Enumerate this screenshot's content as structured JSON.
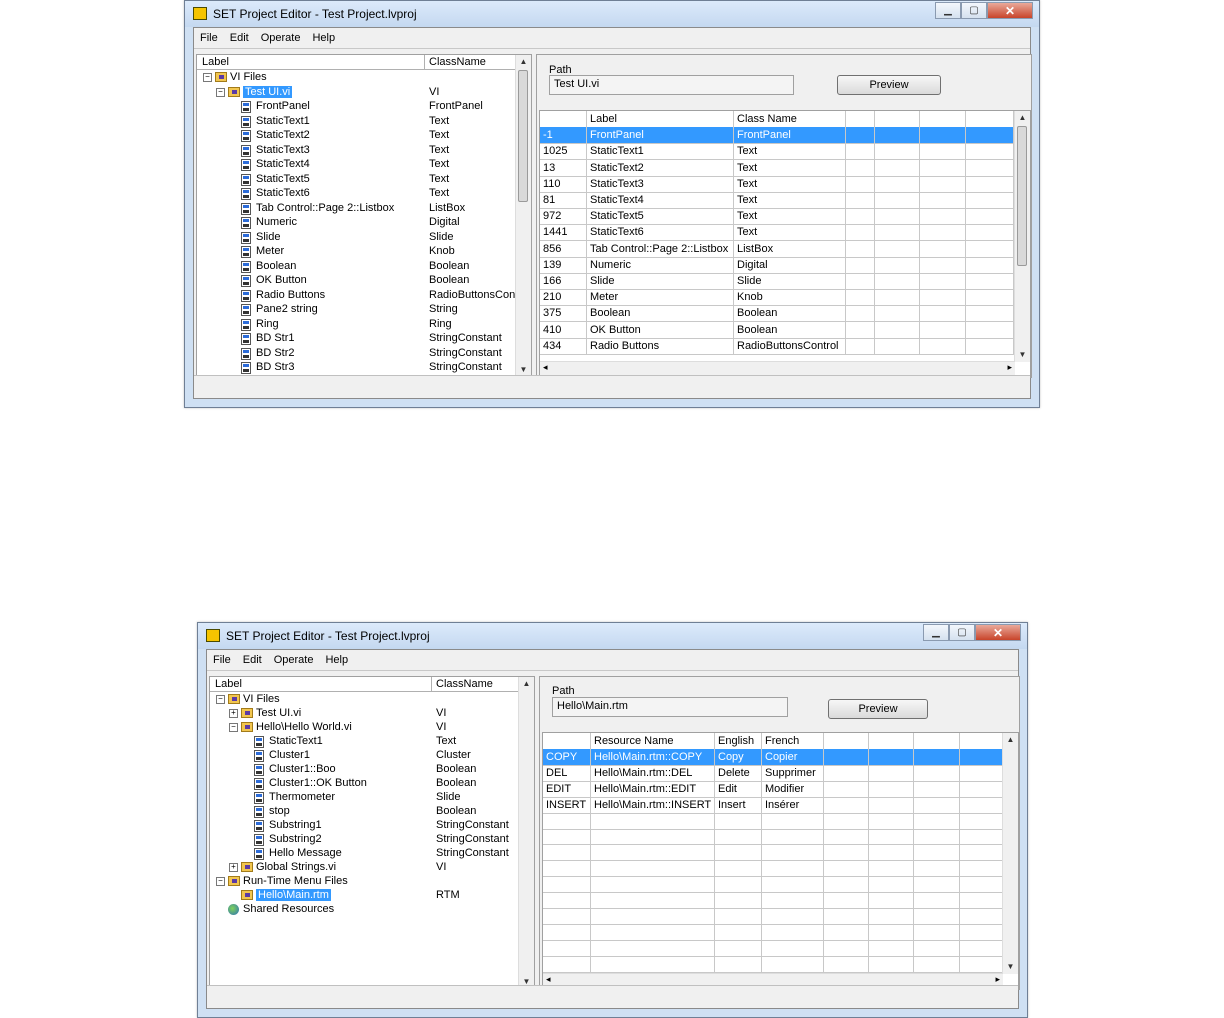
{
  "win1": {
    "title": "SET Project Editor - Test Project.lvproj",
    "menu": [
      "File",
      "Edit",
      "Operate",
      "Help"
    ],
    "tree": {
      "col_label": "Label",
      "col_class": "ClassName",
      "rows": [
        {
          "label": "VI Files",
          "cls": "",
          "icon": "folder-icon",
          "expander": "−"
        },
        {
          "label": "Test UI.vi",
          "cls": "VI",
          "icon": "folder-icon",
          "expander": "−"
        },
        {
          "label": "FrontPanel",
          "cls": "FrontPanel",
          "icon": "vi-icon"
        },
        {
          "label": "StaticText1",
          "cls": "Text",
          "icon": "vi-icon"
        },
        {
          "label": "StaticText2",
          "cls": "Text",
          "icon": "vi-icon"
        },
        {
          "label": "StaticText3",
          "cls": "Text",
          "icon": "vi-icon"
        },
        {
          "label": "StaticText4",
          "cls": "Text",
          "icon": "vi-icon"
        },
        {
          "label": "StaticText5",
          "cls": "Text",
          "icon": "vi-icon"
        },
        {
          "label": "StaticText6",
          "cls": "Text",
          "icon": "vi-icon"
        },
        {
          "label": "Tab Control::Page 2::Listbox",
          "cls": "ListBox",
          "icon": "vi-icon"
        },
        {
          "label": "Numeric",
          "cls": "Digital",
          "icon": "vi-icon"
        },
        {
          "label": "Slide",
          "cls": "Slide",
          "icon": "vi-icon"
        },
        {
          "label": "Meter",
          "cls": "Knob",
          "icon": "vi-icon"
        },
        {
          "label": "Boolean",
          "cls": "Boolean",
          "icon": "vi-icon"
        },
        {
          "label": "OK Button",
          "cls": "Boolean",
          "icon": "vi-icon"
        },
        {
          "label": "Radio Buttons",
          "cls": "RadioButtonsCont",
          "icon": "vi-icon"
        },
        {
          "label": "Pane2 string",
          "cls": "String",
          "icon": "vi-icon"
        },
        {
          "label": "Ring",
          "cls": "Ring",
          "icon": "vi-icon"
        },
        {
          "label": "BD Str1",
          "cls": "StringConstant",
          "icon": "vi-icon"
        },
        {
          "label": "BD Str2",
          "cls": "StringConstant",
          "icon": "vi-icon"
        },
        {
          "label": "BD Str3",
          "cls": "StringConstant",
          "icon": "vi-icon"
        }
      ]
    },
    "path_label": "Path",
    "path_value": "Test UI.vi",
    "preview_label": "Preview",
    "grid": {
      "headers": [
        "",
        "Label",
        "Class Name",
        "",
        "",
        "",
        ""
      ],
      "rows": [
        [
          "-1",
          "FrontPanel",
          "FrontPanel"
        ],
        [
          "1025",
          "StaticText1",
          "Text"
        ],
        [
          "13",
          "StaticText2",
          "Text"
        ],
        [
          "110",
          "StaticText3",
          "Text"
        ],
        [
          "81",
          "StaticText4",
          "Text"
        ],
        [
          "972",
          "StaticText5",
          "Text"
        ],
        [
          "1441",
          "StaticText6",
          "Text"
        ],
        [
          "856",
          "Tab Control::Page 2::Listbox",
          "ListBox"
        ],
        [
          "139",
          "Numeric",
          "Digital"
        ],
        [
          "166",
          "Slide",
          "Slide"
        ],
        [
          "210",
          "Meter",
          "Knob"
        ],
        [
          "375",
          "Boolean",
          "Boolean"
        ],
        [
          "410",
          "OK Button",
          "Boolean"
        ],
        [
          "434",
          "Radio Buttons",
          "RadioButtonsControl"
        ]
      ]
    }
  },
  "win2": {
    "title": "SET Project Editor - Test Project.lvproj",
    "menu": [
      "File",
      "Edit",
      "Operate",
      "Help"
    ],
    "tree": {
      "col_label": "Label",
      "col_class": "ClassName",
      "rows": [
        {
          "label": "VI Files",
          "cls": "",
          "icon": "folder-icon",
          "expander": "−"
        },
        {
          "label": "Test UI.vi",
          "cls": "VI",
          "icon": "folder-icon",
          "expander": "+"
        },
        {
          "label": "Hello\\Hello World.vi",
          "cls": "VI",
          "icon": "folder-icon",
          "expander": "−"
        },
        {
          "label": "StaticText1",
          "cls": "Text",
          "icon": "vi-icon"
        },
        {
          "label": "Cluster1",
          "cls": "Cluster",
          "icon": "vi-icon"
        },
        {
          "label": "Cluster1::Boo",
          "cls": "Boolean",
          "icon": "vi-icon"
        },
        {
          "label": "Cluster1::OK Button",
          "cls": "Boolean",
          "icon": "vi-icon"
        },
        {
          "label": "Thermometer",
          "cls": "Slide",
          "icon": "vi-icon"
        },
        {
          "label": "stop",
          "cls": "Boolean",
          "icon": "vi-icon"
        },
        {
          "label": "Substring1",
          "cls": "StringConstant",
          "icon": "vi-icon"
        },
        {
          "label": "Substring2",
          "cls": "StringConstant",
          "icon": "vi-icon"
        },
        {
          "label": "Hello Message",
          "cls": "StringConstant",
          "icon": "vi-icon"
        },
        {
          "label": "Global Strings.vi",
          "cls": "VI",
          "icon": "folder-icon",
          "expander": "+"
        },
        {
          "label": "Run-Time Menu Files",
          "cls": "",
          "icon": "folder-icon",
          "expander": "−"
        },
        {
          "label": "Hello\\Main.rtm",
          "cls": "RTM",
          "icon": "folder-icon"
        },
        {
          "label": "Shared Resources",
          "cls": "",
          "icon": "globe-icon"
        }
      ]
    },
    "path_label": "Path",
    "path_value": "Hello\\Main.rtm",
    "preview_label": "Preview",
    "grid": {
      "headers": [
        "",
        "Resource Name",
        "English",
        "French",
        "",
        "",
        "",
        ""
      ],
      "rows": [
        [
          "COPY",
          "Hello\\Main.rtm::COPY",
          "Copy",
          "Copier"
        ],
        [
          "DEL",
          "Hello\\Main.rtm::DEL",
          "Delete",
          "Supprimer"
        ],
        [
          "EDIT",
          "Hello\\Main.rtm::EDIT",
          "Edit",
          "Modifier"
        ],
        [
          "INSERT",
          "Hello\\Main.rtm::INSERT",
          "Insert",
          "Insérer"
        ]
      ]
    }
  }
}
